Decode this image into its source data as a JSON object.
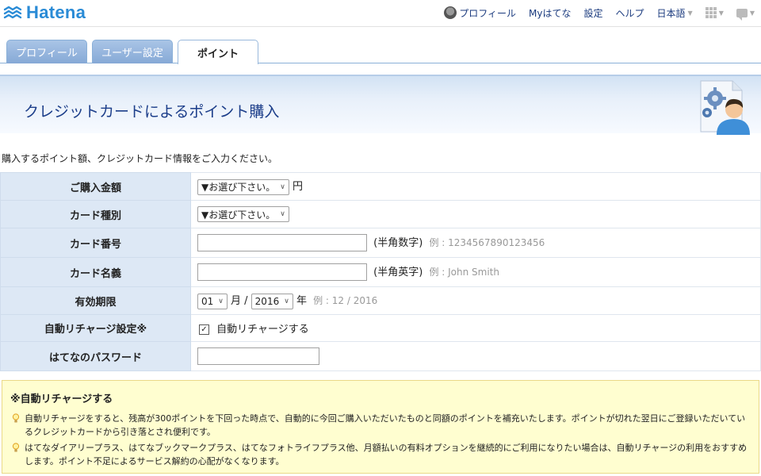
{
  "header": {
    "logo_text": "Hatena",
    "nav": [
      {
        "label": "プロフィール"
      },
      {
        "label": "Myはてな"
      },
      {
        "label": "設定"
      },
      {
        "label": "ヘルプ"
      },
      {
        "label": "日本語"
      }
    ]
  },
  "tabs": [
    {
      "label": "プロフィール",
      "active": false
    },
    {
      "label": "ユーザー設定",
      "active": false
    },
    {
      "label": "ポイント",
      "active": true
    }
  ],
  "page": {
    "title": "クレジットカードによるポイント購入",
    "intro": "購入するポイント額、クレジットカード情報をご入力ください。"
  },
  "form": {
    "amount": {
      "label": "ご購入金額",
      "selected": "▼お選び下さい。",
      "unit": "円"
    },
    "card_type": {
      "label": "カード種別",
      "selected": "▼お選び下さい。"
    },
    "card_number": {
      "label": "カード番号",
      "value": "",
      "hint": "(半角数字)",
      "example": "例 : 1234567890123456"
    },
    "card_name": {
      "label": "カード名義",
      "value": "",
      "hint": "(半角英字)",
      "example": "例 : John Smith"
    },
    "expiry": {
      "label": "有効期限",
      "month": "01",
      "month_unit": "月 /",
      "year": "2016",
      "year_unit": "年",
      "example": "例 : 12 / 2016"
    },
    "auto_recharge": {
      "label": "自動リチャージ設定※",
      "checkbox_label": "自動リチャージする",
      "checked": true
    },
    "password": {
      "label": "はてなのパスワード",
      "value": ""
    }
  },
  "note": {
    "title": "※自動リチャージする",
    "items": [
      "自動リチャージをすると、残高が300ポイントを下回った時点で、自動的に今回ご購入いただいたものと同額のポイントを補充いたします。ポイントが切れた翌日にご登録いただいているクレジットカードから引き落とされ便利です。",
      "はてなダイアリープラス、はてなブックマークプラス、はてなフォトライフプラス他、月額払いの有料オプションを継続的にご利用になりたい場合は、自動リチャージの利用をおすすめします。ポイント不足によるサービス解約の心配がなくなります。"
    ]
  },
  "colors": {
    "brand": "#2a8bd6",
    "title": "#1c3e8a",
    "label_bg": "#dde8f5",
    "note_bg": "#fffed0"
  }
}
